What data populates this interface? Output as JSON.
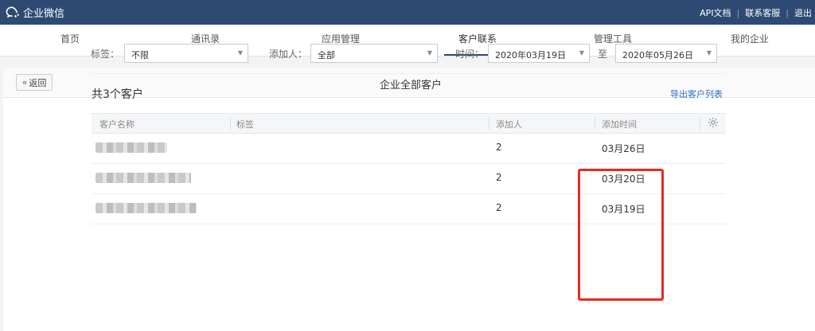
{
  "app": {
    "name": "企业微信",
    "logo_icon": "wecom-logo-icon"
  },
  "top_links": [
    "API文档",
    "联系客服",
    "退出"
  ],
  "nav": {
    "active": "客户联系",
    "items": [
      "首页",
      "通讯录",
      "应用管理",
      "客户联系",
      "管理工具",
      "我的企业"
    ]
  },
  "page": {
    "back_label": "返回",
    "title": "企业全部客户"
  },
  "filters": {
    "tag_label": "标签：",
    "tag_value": "不限",
    "adder_label": "添加人：",
    "adder_value": "全部",
    "time_label": "时间：",
    "time_start": "2020年03月19日",
    "time_sep": "至",
    "time_end": "2020年05月26日"
  },
  "summary": {
    "count_label": "共3个客户",
    "export_label": "导出客户列表"
  },
  "table": {
    "columns": [
      "客户名称",
      "标签",
      "添加人",
      "添加时间"
    ],
    "settings_icon": "gear-icon",
    "rows": [
      {
        "name": "",
        "tags": "",
        "adder": "2",
        "time": "03月26日"
      },
      {
        "name": "",
        "tags": "",
        "adder": "2",
        "time": "03月20日"
      },
      {
        "name": "",
        "tags": "",
        "adder": "2",
        "time": "03月19日"
      }
    ]
  },
  "colors": {
    "topbar": "#2e4a73",
    "highlight": "#e52b1f",
    "link": "#2e6bc4"
  }
}
